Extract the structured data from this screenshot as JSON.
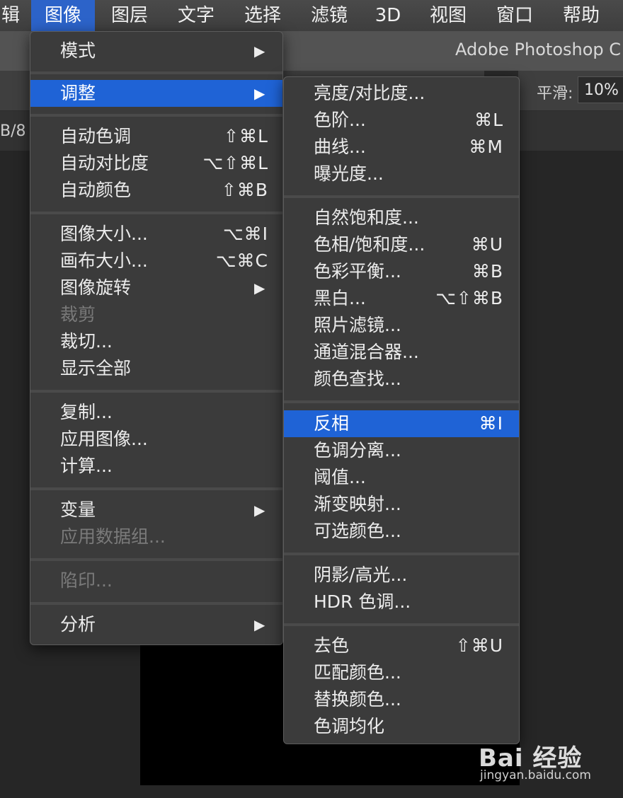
{
  "menubar": {
    "items": [
      "辑",
      "图像",
      "图层",
      "文字",
      "选择",
      "滤镜",
      "3D",
      "视图",
      "窗口",
      "帮助"
    ],
    "active_index": 1
  },
  "titlebar": {
    "app_title": "Adobe Photoshop C"
  },
  "options_bar": {
    "smooth_label": "平滑:",
    "smooth_value": "10%"
  },
  "doc_tab": {
    "fragment": "B/8"
  },
  "image_menu": {
    "items": [
      {
        "label": "模式",
        "shortcut": "",
        "submenu": true
      },
      {
        "label": "调整",
        "shortcut": "",
        "submenu": true,
        "highlighted": true
      },
      {
        "label": "自动色调",
        "shortcut": "⇧⌘L"
      },
      {
        "label": "自动对比度",
        "shortcut": "⌥⇧⌘L"
      },
      {
        "label": "自动颜色",
        "shortcut": "⇧⌘B"
      },
      {
        "label": "图像大小...",
        "shortcut": "⌥⌘I"
      },
      {
        "label": "画布大小...",
        "shortcut": "⌥⌘C"
      },
      {
        "label": "图像旋转",
        "shortcut": "",
        "submenu": true
      },
      {
        "label": "裁剪",
        "shortcut": "",
        "disabled": true
      },
      {
        "label": "裁切...",
        "shortcut": ""
      },
      {
        "label": "显示全部",
        "shortcut": ""
      },
      {
        "label": "复制...",
        "shortcut": ""
      },
      {
        "label": "应用图像...",
        "shortcut": ""
      },
      {
        "label": "计算...",
        "shortcut": ""
      },
      {
        "label": "变量",
        "shortcut": "",
        "submenu": true
      },
      {
        "label": "应用数据组...",
        "shortcut": "",
        "disabled": true
      },
      {
        "label": "陷印...",
        "shortcut": "",
        "disabled": true
      },
      {
        "label": "分析",
        "shortcut": "",
        "submenu": true
      }
    ],
    "submenu_arrow": "▶"
  },
  "adjustments_menu": {
    "items": [
      {
        "label": "亮度/对比度...",
        "shortcut": ""
      },
      {
        "label": "色阶...",
        "shortcut": "⌘L"
      },
      {
        "label": "曲线...",
        "shortcut": "⌘M"
      },
      {
        "label": "曝光度...",
        "shortcut": ""
      },
      {
        "label": "自然饱和度...",
        "shortcut": ""
      },
      {
        "label": "色相/饱和度...",
        "shortcut": "⌘U"
      },
      {
        "label": "色彩平衡...",
        "shortcut": "⌘B"
      },
      {
        "label": "黑白...",
        "shortcut": "⌥⇧⌘B"
      },
      {
        "label": "照片滤镜...",
        "shortcut": ""
      },
      {
        "label": "通道混合器...",
        "shortcut": ""
      },
      {
        "label": "颜色查找...",
        "shortcut": ""
      },
      {
        "label": "反相",
        "shortcut": "⌘I",
        "highlighted": true
      },
      {
        "label": "色调分离...",
        "shortcut": ""
      },
      {
        "label": "阈值...",
        "shortcut": ""
      },
      {
        "label": "渐变映射...",
        "shortcut": ""
      },
      {
        "label": "可选颜色...",
        "shortcut": ""
      },
      {
        "label": "阴影/高光...",
        "shortcut": ""
      },
      {
        "label": "HDR 色调...",
        "shortcut": ""
      },
      {
        "label": "去色",
        "shortcut": "⇧⌘U"
      },
      {
        "label": "匹配颜色...",
        "shortcut": ""
      },
      {
        "label": "替换颜色...",
        "shortcut": ""
      },
      {
        "label": "色调均化",
        "shortcut": ""
      }
    ]
  },
  "watermark": {
    "logo": "Bai 经验",
    "url": "jingyan.baidu.com"
  },
  "colors": {
    "highlight": "#1f63d6",
    "menu_bg": "#3b3b3b",
    "disabled_text": "#7a7a7a"
  }
}
